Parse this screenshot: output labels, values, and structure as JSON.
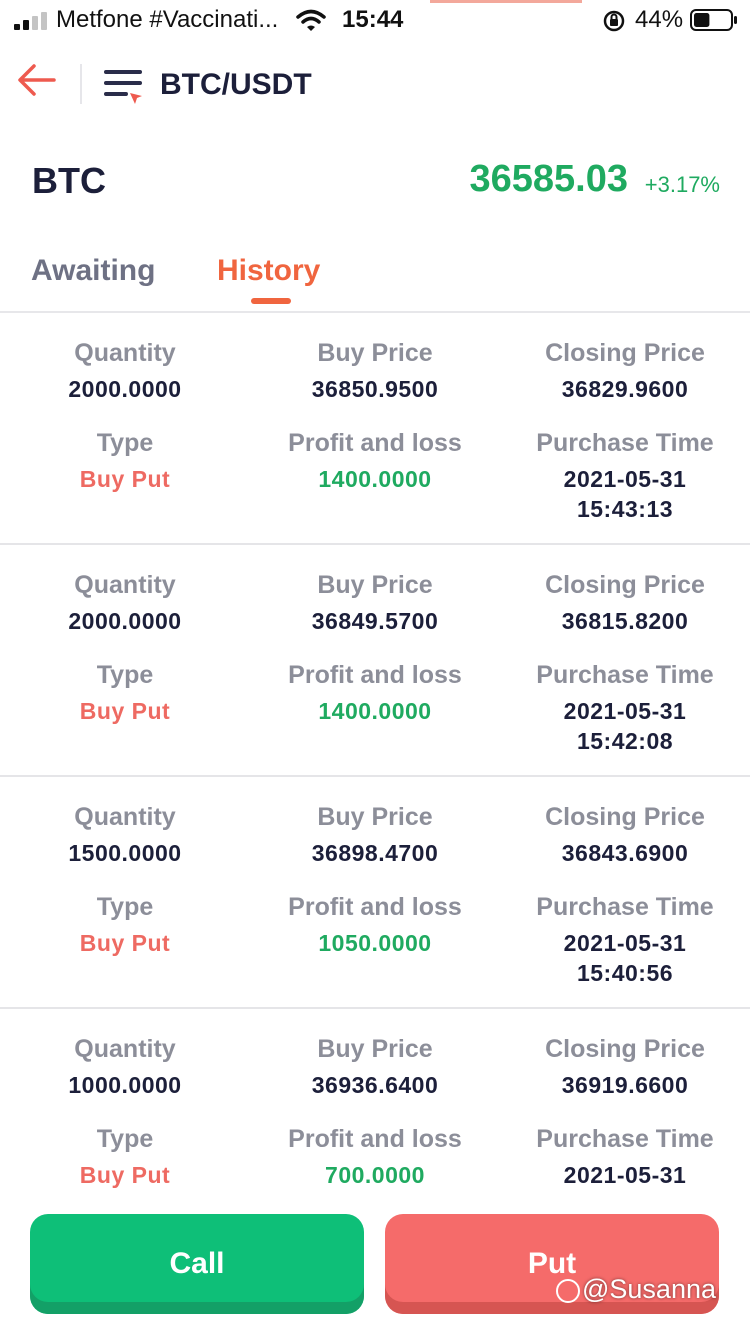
{
  "status_bar": {
    "carrier": "Metfone #Vaccinati...",
    "time": "15:44",
    "battery_percent": "44%",
    "battery_level": 0.44
  },
  "header": {
    "pair": "BTC/USDT"
  },
  "ticker": {
    "symbol": "BTC",
    "price": "36585.03",
    "change": "+3.17%",
    "up_color": "#1faa60"
  },
  "tabs": [
    {
      "label": "Awaiting",
      "active": false
    },
    {
      "label": "History",
      "active": true
    }
  ],
  "accent_color": "#f0653f",
  "labels": {
    "quantity": "Quantity",
    "buy_price": "Buy Price",
    "closing_price": "Closing Price",
    "type": "Type",
    "profit_loss": "Profit and loss",
    "purchase_time": "Purchase Time"
  },
  "records": [
    {
      "quantity": "2000.0000",
      "buy_price": "36850.9500",
      "closing_price": "36829.9600",
      "type": "Buy Put",
      "profit_loss": "1400.0000",
      "purchase_date": "2021-05-31",
      "purchase_time": "15:43:13"
    },
    {
      "quantity": "2000.0000",
      "buy_price": "36849.5700",
      "closing_price": "36815.8200",
      "type": "Buy Put",
      "profit_loss": "1400.0000",
      "purchase_date": "2021-05-31",
      "purchase_time": "15:42:08"
    },
    {
      "quantity": "1500.0000",
      "buy_price": "36898.4700",
      "closing_price": "36843.6900",
      "type": "Buy Put",
      "profit_loss": "1050.0000",
      "purchase_date": "2021-05-31",
      "purchase_time": "15:40:56"
    },
    {
      "quantity": "1000.0000",
      "buy_price": "36936.6400",
      "closing_price": "36919.6600",
      "type": "Buy Put",
      "profit_loss": "700.0000",
      "purchase_date": "2021-05-31",
      "purchase_time": ""
    }
  ],
  "buttons": {
    "call": "Call",
    "put": "Put",
    "call_color": "#0ebf78",
    "put_color": "#f56b6a"
  },
  "watermark": "@Susanna"
}
